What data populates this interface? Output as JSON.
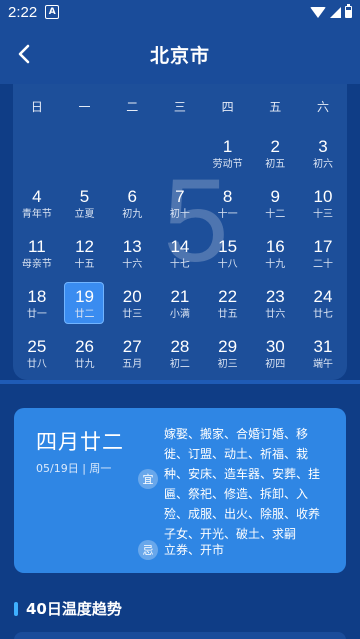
{
  "status_bar": {
    "time": "2:22",
    "notification_icon": "A"
  },
  "header": {
    "title": "北京市",
    "back_icon": "chevron-left-icon"
  },
  "calendar": {
    "month_number": "5",
    "weekdays": [
      "日",
      "一",
      "二",
      "三",
      "四",
      "五",
      "六"
    ],
    "weeks": [
      [
        null,
        null,
        null,
        null,
        {
          "day": "1",
          "lunar": "劳动节"
        },
        {
          "day": "2",
          "lunar": "初五"
        },
        {
          "day": "3",
          "lunar": "初六"
        }
      ],
      [
        {
          "day": "4",
          "lunar": "青年节"
        },
        {
          "day": "5",
          "lunar": "立夏"
        },
        {
          "day": "6",
          "lunar": "初九"
        },
        {
          "day": "7",
          "lunar": "初十"
        },
        {
          "day": "8",
          "lunar": "十一"
        },
        {
          "day": "9",
          "lunar": "十二"
        },
        {
          "day": "10",
          "lunar": "十三"
        }
      ],
      [
        {
          "day": "11",
          "lunar": "母亲节"
        },
        {
          "day": "12",
          "lunar": "十五"
        },
        {
          "day": "13",
          "lunar": "十六"
        },
        {
          "day": "14",
          "lunar": "十七"
        },
        {
          "day": "15",
          "lunar": "十八"
        },
        {
          "day": "16",
          "lunar": "十九"
        },
        {
          "day": "17",
          "lunar": "二十"
        }
      ],
      [
        {
          "day": "18",
          "lunar": "廿一"
        },
        {
          "day": "19",
          "lunar": "廿二",
          "selected": true
        },
        {
          "day": "20",
          "lunar": "廿三"
        },
        {
          "day": "21",
          "lunar": "小满"
        },
        {
          "day": "22",
          "lunar": "廿五"
        },
        {
          "day": "23",
          "lunar": "廿六"
        },
        {
          "day": "24",
          "lunar": "廿七"
        }
      ],
      [
        {
          "day": "25",
          "lunar": "廿八"
        },
        {
          "day": "26",
          "lunar": "廿九"
        },
        {
          "day": "27",
          "lunar": "五月"
        },
        {
          "day": "28",
          "lunar": "初二"
        },
        {
          "day": "29",
          "lunar": "初三"
        },
        {
          "day": "30",
          "lunar": "初四"
        },
        {
          "day": "31",
          "lunar": "端午"
        }
      ]
    ]
  },
  "almanac": {
    "lunar_date": "四月廿二",
    "solar_date": "05/19日 | 周一",
    "yi_label": "宜",
    "yi_text": "嫁娶、搬家、合婚订婚、移徙、订盟、动土、祈福、栽种、安床、造车器、安葬、挂匾、祭祀、修造、拆卸、入殓、成服、出火、除服、收养子女、开光、破土、求嗣",
    "ji_label": "忌",
    "ji_text": "立券、开市"
  },
  "trend": {
    "title": "40日温度趋势"
  },
  "colors": {
    "background": "#0f3d86",
    "header": "#1a4c9a",
    "selected": "#3a8cf0",
    "almanac": "#2f86e4",
    "accent": "#3fb0ff"
  }
}
